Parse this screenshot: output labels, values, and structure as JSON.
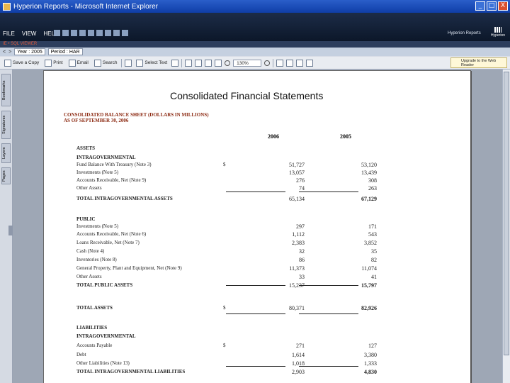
{
  "window": {
    "title": "Hyperion Reports - Microsoft Internet Explorer",
    "controls": [
      "_",
      "□",
      "X"
    ]
  },
  "menubar": {
    "menus": [
      "FILE",
      "VIEW",
      "HELP"
    ],
    "brand_text": "Hyperion Reports",
    "brand_logo_text": "Hyperion"
  },
  "breadcrumb": "IE • SQL VIEWER",
  "pov": {
    "nav_prev": "<",
    "nav_next": ">",
    "year": "Year : 2005",
    "period": "Period : HAR"
  },
  "viewer_toolbar": {
    "save_copy": "Save a Copy",
    "print": "Print",
    "email": "Email",
    "search": "Search",
    "select_text": "Select Text",
    "zoom": "130%",
    "help_tip": "Upgrade to the Web Reader"
  },
  "side_tabs": [
    "Bookmarks",
    "Signatures",
    "Layers",
    "Pages"
  ],
  "document": {
    "title": "Consolidated Financial Statements",
    "sheet_title": "CONSOLIDATED BALANCE SHEET (DOLLARS IN MILLIONS)",
    "as_of": "AS OF SEPTEMBER 30, 2006",
    "columns": [
      "2006",
      "2005"
    ],
    "rows": [
      {
        "label": "ASSETS",
        "cur": "",
        "v1": "",
        "v2": "",
        "style": "heading"
      },
      {
        "label": "INTRAGOVERNMENTAL",
        "cur": "",
        "v1": "",
        "v2": "",
        "style": "heading"
      },
      {
        "label": "Fund Balance With Treasury (Note 3)",
        "cur": "$",
        "v1": "51,727",
        "v2": "53,120",
        "style": ""
      },
      {
        "label": "Investments (Note 5)",
        "cur": "",
        "v1": "13,057",
        "v2": "13,439",
        "style": ""
      },
      {
        "label": "Accounts Receivable, Net (Note 9)",
        "cur": "",
        "v1": "276",
        "v2": "308",
        "style": ""
      },
      {
        "label": "Other Assets",
        "cur": "",
        "v1": "74",
        "v2": "263",
        "style": ""
      },
      {
        "label": "TOTAL INTRAGOVERNMENTAL ASSETS",
        "cur": "",
        "v1": "65,134",
        "v2": "67,129",
        "style": "bold"
      },
      {
        "label": "PUBLIC",
        "cur": "",
        "v1": "",
        "v2": "",
        "style": "heading"
      },
      {
        "label": "Investments (Note 5)",
        "cur": "",
        "v1": "297",
        "v2": "171",
        "style": ""
      },
      {
        "label": "Accounts Receivable, Net (Note 6)",
        "cur": "",
        "v1": "1,112",
        "v2": "543",
        "style": ""
      },
      {
        "label": "Loans Receivable, Net (Note 7)",
        "cur": "",
        "v1": "2,383",
        "v2": "3,852",
        "style": ""
      },
      {
        "label": "Cash (Note 4)",
        "cur": "",
        "v1": "32",
        "v2": "35",
        "style": ""
      },
      {
        "label": "Inventories (Note 8)",
        "cur": "",
        "v1": "86",
        "v2": "82",
        "style": ""
      },
      {
        "label": "General Property, Plant and Equipment, Net (Note 9)",
        "cur": "",
        "v1": "11,373",
        "v2": "11,074",
        "style": ""
      },
      {
        "label": "Other Assets",
        "cur": "",
        "v1": "33",
        "v2": "41",
        "style": ""
      },
      {
        "label": "TOTAL PUBLIC ASSETS",
        "cur": "",
        "v1": "15,237",
        "v2": "15,797",
        "style": "bold"
      },
      {
        "label": "TOTAL ASSETS",
        "cur": "$",
        "v1": "80,371",
        "v2": "82,926",
        "style": "bold"
      },
      {
        "label": "LIABILITIES",
        "cur": "",
        "v1": "",
        "v2": "",
        "style": "heading"
      },
      {
        "label": "INTRAGOVERNMENTAL",
        "cur": "",
        "v1": "",
        "v2": "",
        "style": "heading"
      },
      {
        "label": "Accounts Payable",
        "cur": "$",
        "v1": "271",
        "v2": "127",
        "style": ""
      },
      {
        "label": "Debt",
        "cur": "",
        "v1": "1,614",
        "v2": "3,380",
        "style": ""
      },
      {
        "label": "Other Liabilities (Note 13)",
        "cur": "",
        "v1": "1,018",
        "v2": "1,333",
        "style": ""
      },
      {
        "label": "TOTAL INTRAGOVERNMENTAL LIABILITIES",
        "cur": "",
        "v1": "2,903",
        "v2": "4,830",
        "style": "bold"
      }
    ]
  }
}
